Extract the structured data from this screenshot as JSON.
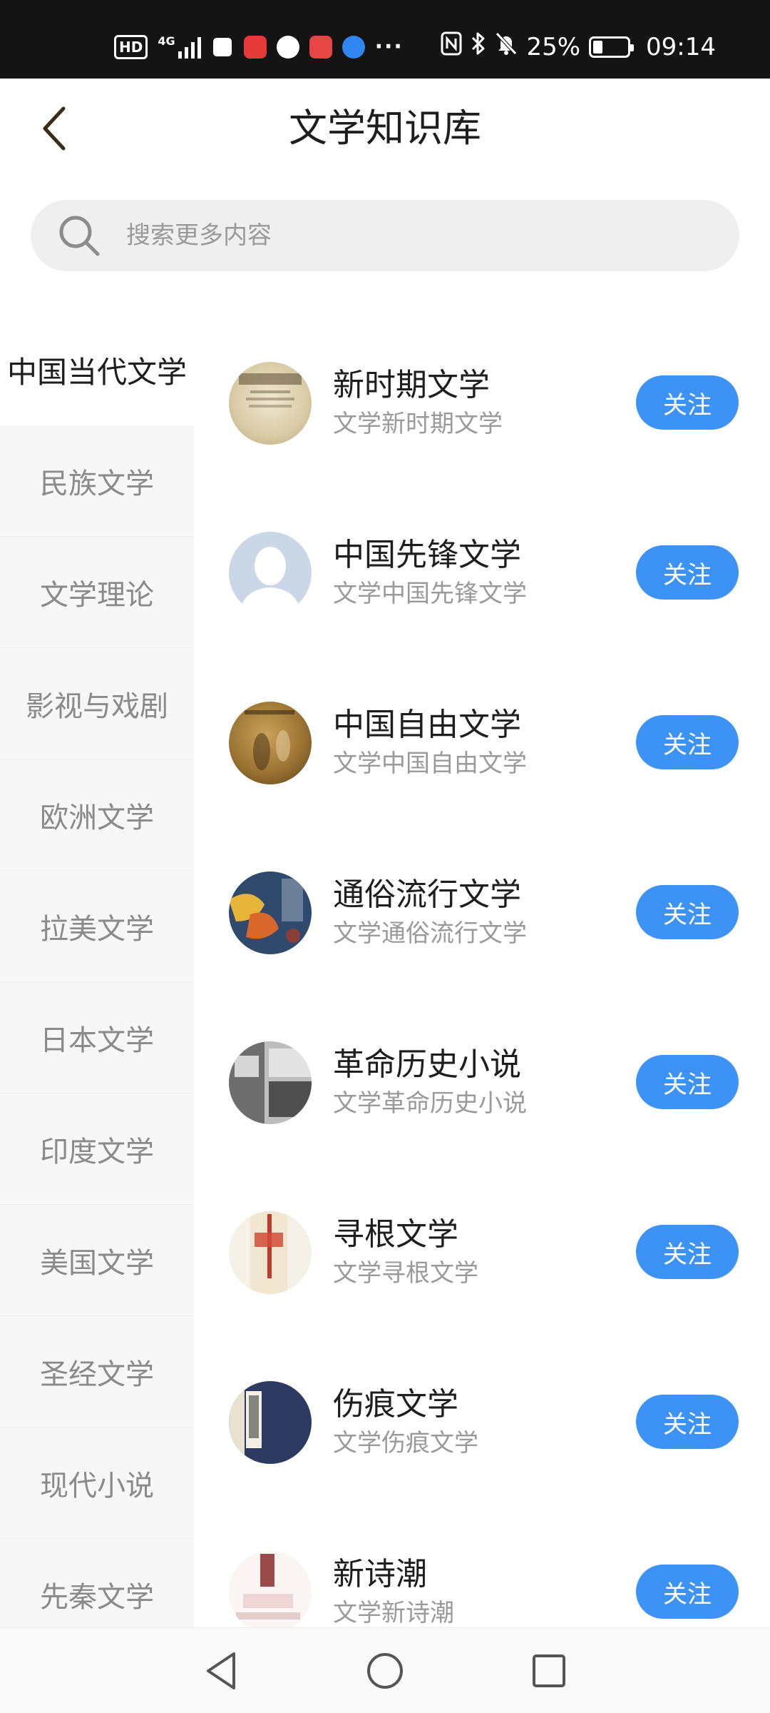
{
  "status_bar": {
    "hd_badge": "HD",
    "network_type": "4G",
    "signal_bars": 4,
    "more_indicator": "···",
    "battery_percent": "25%",
    "battery_level": 0.25,
    "time": "09:14",
    "icons": [
      "hd-icon",
      "signal-icon",
      "app-icon",
      "huawei-icon",
      "app-icon",
      "reader-icon",
      "browser-icon",
      "nfc-icon",
      "bluetooth-icon",
      "mute-icon",
      "battery-icon"
    ]
  },
  "header": {
    "title": "文学知识库",
    "back_icon": "chevron-left-icon"
  },
  "search": {
    "placeholder": "搜索更多内容",
    "icon": "search-icon"
  },
  "sidebar": {
    "active_index": 0,
    "items": [
      {
        "label": "中国当代文学"
      },
      {
        "label": "民族文学"
      },
      {
        "label": "文学理论"
      },
      {
        "label": "影视与戏剧"
      },
      {
        "label": "欧洲文学"
      },
      {
        "label": "拉美文学"
      },
      {
        "label": "日本文学"
      },
      {
        "label": "印度文学"
      },
      {
        "label": "美国文学"
      },
      {
        "label": "圣经文学"
      },
      {
        "label": "现代小说"
      },
      {
        "label": "先秦文学"
      }
    ]
  },
  "topics": [
    {
      "title": "新时期文学",
      "subtitle": "文学新时期文学",
      "button": "关注"
    },
    {
      "title": "中国先锋文学",
      "subtitle": "文学中国先锋文学",
      "button": "关注"
    },
    {
      "title": "中国自由文学",
      "subtitle": "文学中国自由文学",
      "button": "关注"
    },
    {
      "title": "通俗流行文学",
      "subtitle": "文学通俗流行文学",
      "button": "关注"
    },
    {
      "title": "革命历史小说",
      "subtitle": "文学革命历史小说",
      "button": "关注"
    },
    {
      "title": "寻根文学",
      "subtitle": "文学寻根文学",
      "button": "关注"
    },
    {
      "title": "伤痕文学",
      "subtitle": "文学伤痕文学",
      "button": "关注"
    },
    {
      "title": "新诗潮",
      "subtitle": "文学新诗潮",
      "button": "关注"
    }
  ],
  "colors": {
    "accent": "#3d93f5",
    "status_bar_bg": "#141414",
    "sidebar_bg": "#f7f7f7",
    "search_bg": "#efefef"
  },
  "nav_bar": {
    "icons": [
      "back-triangle-icon",
      "home-circle-icon",
      "recents-square-icon"
    ]
  }
}
